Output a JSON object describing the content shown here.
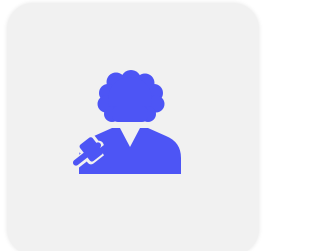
{
  "card": {
    "background": "#f1f1f1"
  },
  "icon": {
    "name": "judge-with-gavel-icon",
    "color": "#4d55f5"
  }
}
